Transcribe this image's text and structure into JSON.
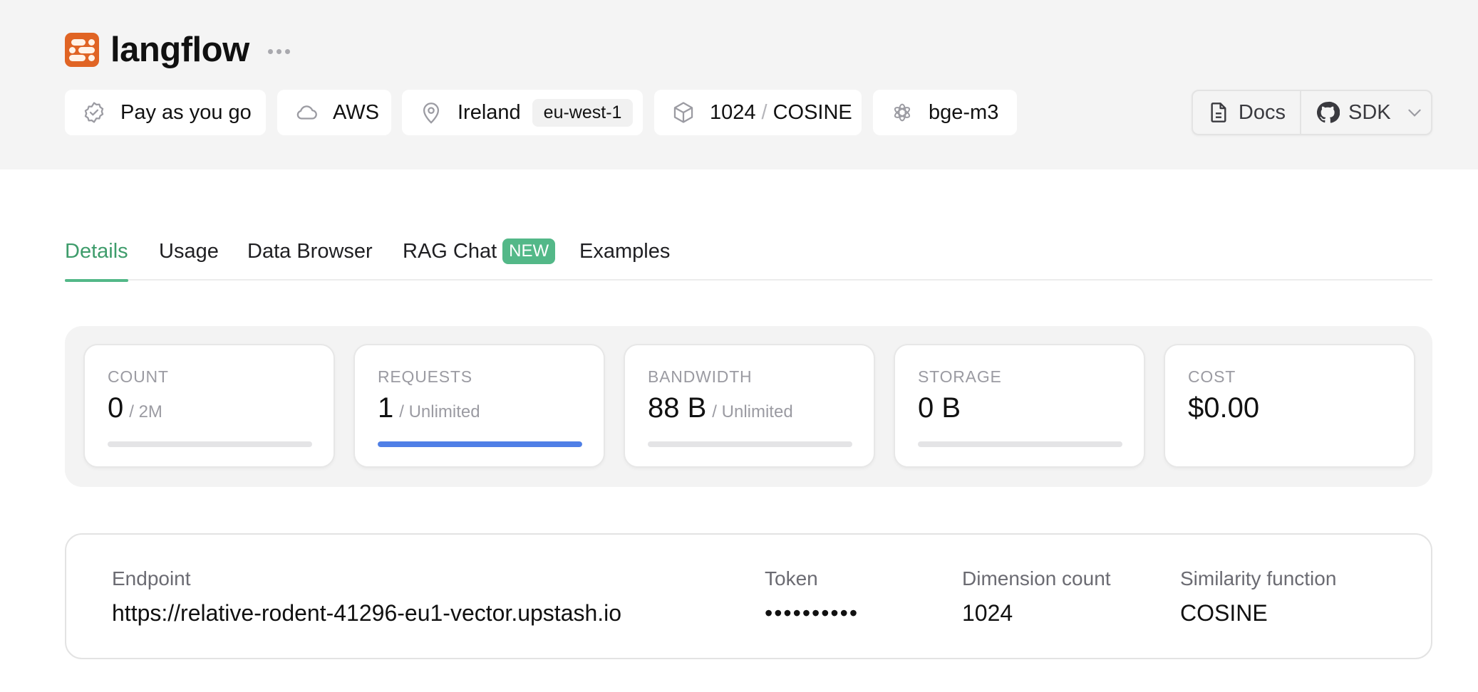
{
  "header": {
    "title": "langflow",
    "more_icon": "ellipsis-icon",
    "pills": [
      {
        "icon": "verified-badge-icon",
        "label": "Pay as you go"
      },
      {
        "icon": "cloud-icon",
        "label": "AWS"
      },
      {
        "icon": "map-pin-icon",
        "label": "Ireland",
        "chip": "eu-west-1"
      },
      {
        "icon": "cube-icon",
        "label": "1024",
        "separator": "/",
        "label2": "COSINE"
      },
      {
        "icon": "openai-icon",
        "label": "bge-m3"
      }
    ],
    "external": {
      "docs_label": "Docs",
      "sdk_label": "SDK"
    }
  },
  "tabs": [
    {
      "label": "Details",
      "active": true
    },
    {
      "label": "Usage"
    },
    {
      "label": "Data Browser"
    },
    {
      "label": "RAG Chat",
      "badge": "NEW"
    },
    {
      "label": "Examples"
    }
  ],
  "stats": [
    {
      "label": "COUNT",
      "value": "0",
      "limit": "/ 2M",
      "progress": 0
    },
    {
      "label": "REQUESTS",
      "value": "1",
      "limit": "/ Unlimited",
      "progress": 1.0
    },
    {
      "label": "BANDWIDTH",
      "value": "88 B",
      "limit": "/ Unlimited",
      "progress": 0
    },
    {
      "label": "STORAGE",
      "value": "0 B",
      "limit": "",
      "progress": 0
    },
    {
      "label": "COST",
      "value": "$0.00",
      "limit": ""
    }
  ],
  "colors": {
    "brand": "#e06424",
    "accent_green": "#53b888",
    "progress_blue": "#4f7fe6"
  },
  "details": {
    "endpoint_label": "Endpoint",
    "endpoint_value": "https://relative-rodent-41296-eu1-vector.upstash.io",
    "token_label": "Token",
    "token_value": "••••••••••",
    "dimension_label": "Dimension count",
    "dimension_value": "1024",
    "similarity_label": "Similarity function",
    "similarity_value": "COSINE"
  }
}
